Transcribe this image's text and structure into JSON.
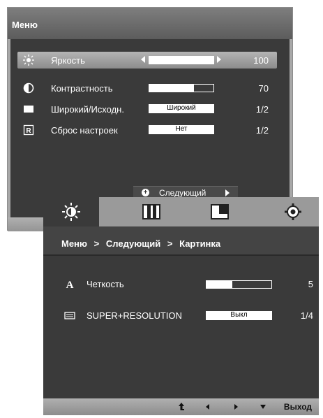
{
  "menu1": {
    "title": "Меню",
    "items": [
      {
        "label": "Яркость",
        "value": "100",
        "level": 1.0
      },
      {
        "label": "Контрастность",
        "value": "70",
        "level": 0.7
      },
      {
        "label": "Широкий/Исходн.",
        "box": "Широкий",
        "value": "1/2"
      },
      {
        "label": "Сброс настроек",
        "box": "Нет",
        "value": "1/2"
      }
    ],
    "next_label": "Следующий"
  },
  "menu2": {
    "tabs": [
      "brightness-tab",
      "picture-tab",
      "screen-tab",
      "settings-tab"
    ],
    "breadcrumb": {
      "first": "Меню",
      "sep1": ">",
      "second": "Следующий",
      "sep2": ">",
      "third": "Картинка"
    },
    "items": [
      {
        "label": "Четкость",
        "value": "5",
        "level": 0.4,
        "icon": "A"
      },
      {
        "label": "SUPER+RESOLUTION",
        "box": "Выкл",
        "value": "1/4"
      }
    ],
    "footer": {
      "exit": "Выход"
    }
  }
}
